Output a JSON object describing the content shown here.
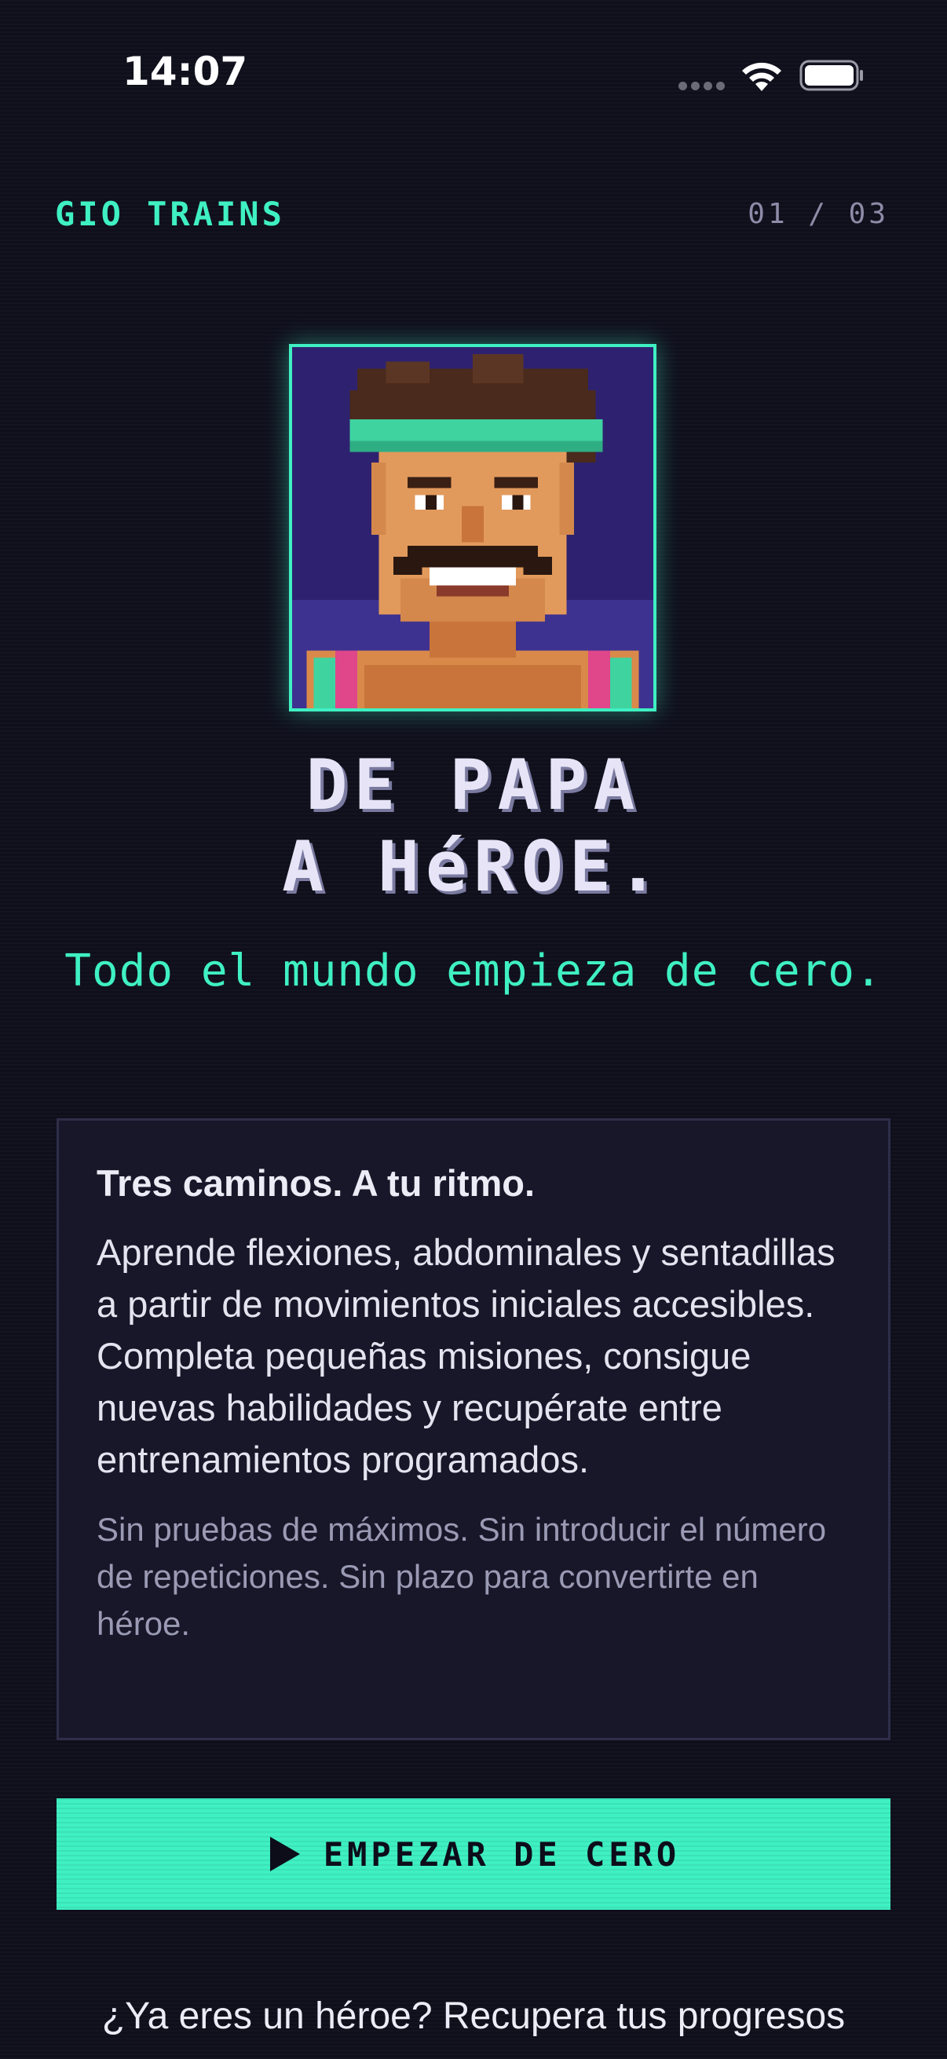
{
  "status_bar": {
    "time": "14:07",
    "icons": [
      "signal-dots-icon",
      "wifi-icon",
      "battery-icon"
    ]
  },
  "header": {
    "brand": "GIO TRAINS",
    "pager": "01 / 03"
  },
  "hero": {
    "portrait_alt_icon": "pixel-portrait-icon",
    "title_line_1": "DE PAPA",
    "title_line_2": "A HéROE.",
    "tagline": "Todo el mundo empieza de cero."
  },
  "card": {
    "title": "Tres caminos. A tu ritmo.",
    "body": "Aprende flexiones, abdominales y sentadillas a partir de movimientos iniciales accesibles. Completa pequeñas misiones, consigue nuevas habilidades y recupérate entre entrenamientos programados.",
    "note": "Sin pruebas de máximos. Sin introducir el número de repeticiones. Sin plazo para convertirte en héroe."
  },
  "cta": {
    "icon": "play-icon",
    "label": "EMPEZAR DE CERO"
  },
  "recover": {
    "label": "¿Ya eres un héroe? Recupera tus progresos"
  },
  "colors": {
    "background": "#0f0f1c",
    "accent": "#3ff0c2",
    "card_bg": "#171729",
    "muted": "#8d8ca8"
  }
}
